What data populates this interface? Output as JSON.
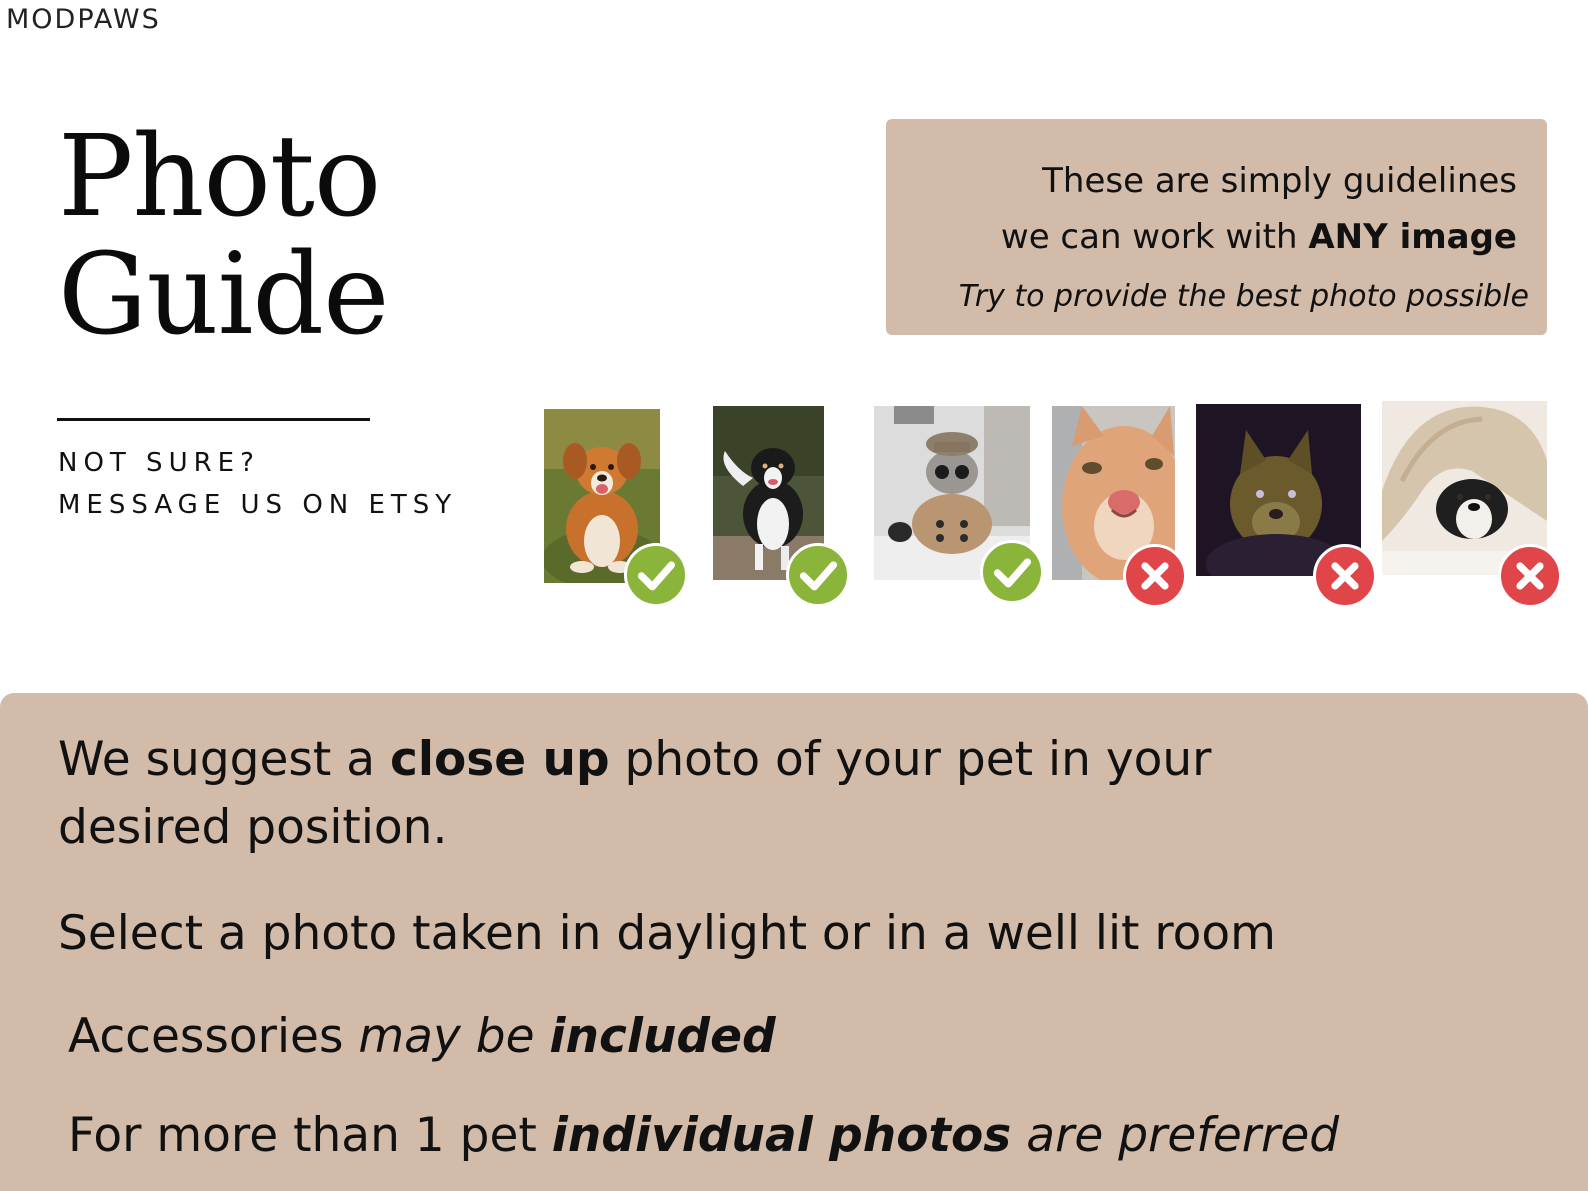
{
  "brand": "MODPAWS",
  "title": {
    "line1": "Photo",
    "line2": "Guide"
  },
  "unsure": {
    "line1": "NOT SURE?",
    "line2": "MESSAGE US ON ETSY"
  },
  "note": {
    "line1": "These are simply guidelines",
    "line2_prefix": "we can work with ",
    "line2_bold": "ANY image",
    "line3": "Try to provide the best photo possible"
  },
  "photos": [
    {
      "subject": "dog-lying-grass",
      "verdict": "good"
    },
    {
      "subject": "dog-running",
      "verdict": "good"
    },
    {
      "subject": "cat-with-hat-and-coat",
      "verdict": "good"
    },
    {
      "subject": "cat-closeup-selfie",
      "verdict": "bad"
    },
    {
      "subject": "dog-dark-photo",
      "verdict": "bad"
    },
    {
      "subject": "dog-under-blanket",
      "verdict": "bad"
    }
  ],
  "colors": {
    "panel": "#d2bba9",
    "good": "#8ab43a",
    "bad": "#df4549"
  },
  "tips": {
    "t1_a": "We suggest a ",
    "t1_b": "close up",
    "t1_c": " photo of your pet in your desired position.",
    "t2": "Select a photo taken in daylight or in a well lit room",
    "t3_a": "Accessories ",
    "t3_b": "may be ",
    "t3_c": "included",
    "t4_a": "For more than 1 pet ",
    "t4_b": "individual photos",
    "t4_c": " are preferred"
  }
}
